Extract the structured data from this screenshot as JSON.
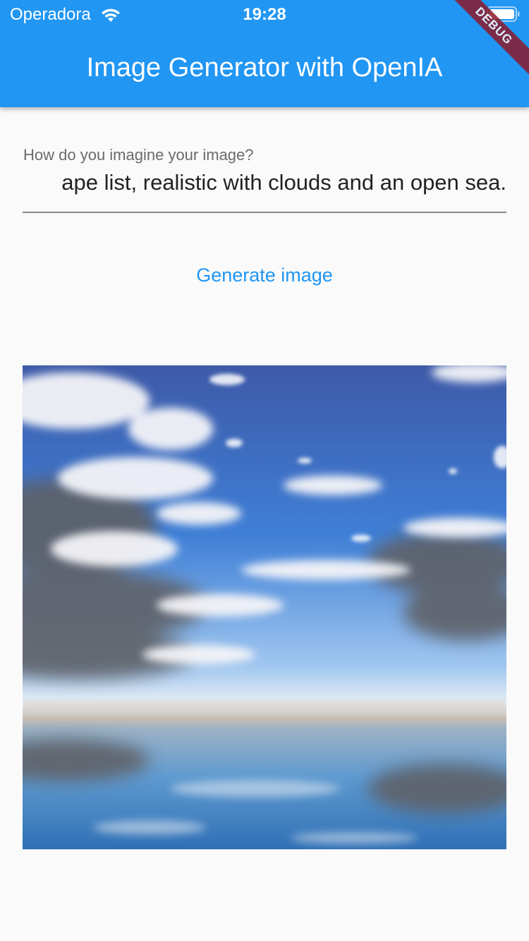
{
  "status_bar": {
    "carrier": "Operadora",
    "time": "19:28",
    "wifi_icon": "wifi-icon",
    "battery_icon": "battery-full-icon"
  },
  "app_bar": {
    "title": "Image Generator with OpenIA",
    "background_color": "#2196f3",
    "debug_banner": "DEBUG"
  },
  "form": {
    "label": "How do you imagine your image?",
    "prompt_value": "ape list, realistic with clouds and an open sea.",
    "generate_label": "Generate image",
    "accent_color": "#2196f3"
  },
  "result": {
    "image_description_icon": "generated-image-sky-over-sea"
  }
}
